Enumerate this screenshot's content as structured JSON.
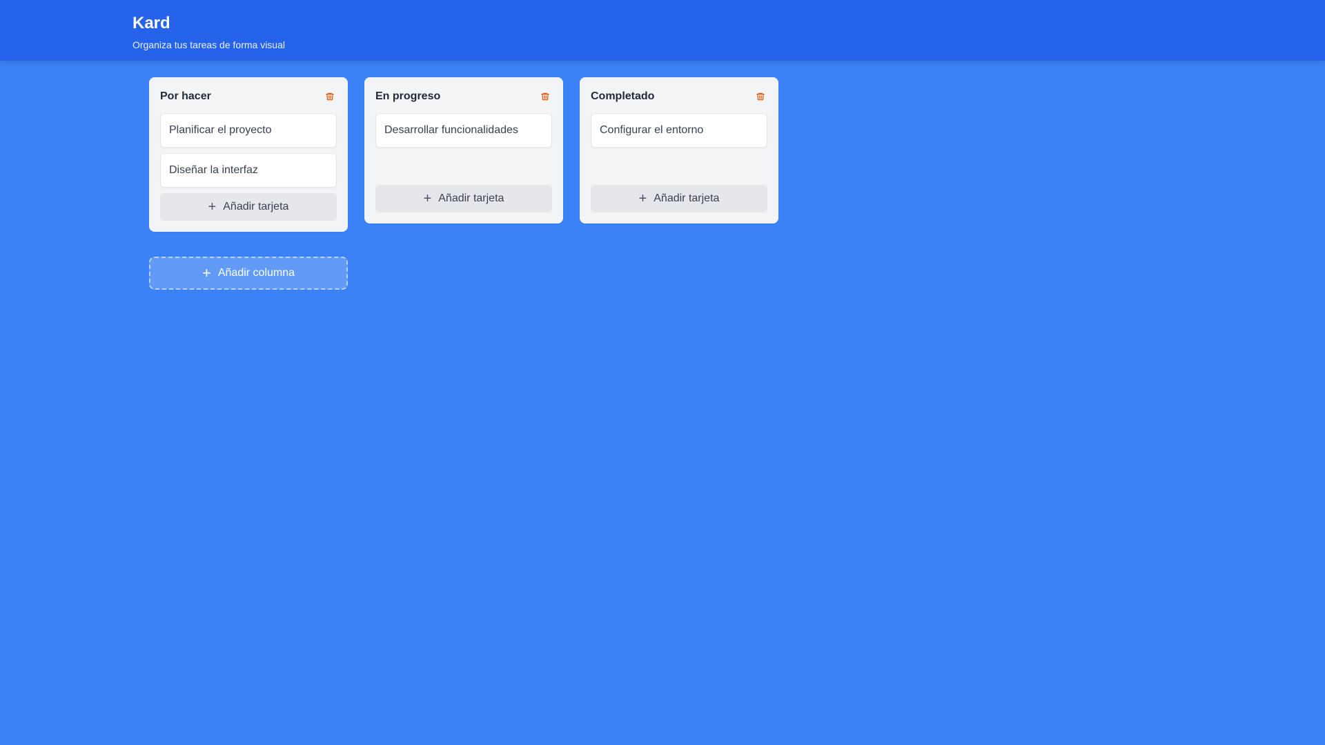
{
  "header": {
    "title": "Kard",
    "subtitle": "Organiza tus tareas de forma visual"
  },
  "columns": [
    {
      "title": "Por hacer",
      "cards": [
        "Planificar el proyecto",
        "Diseñar la interfaz"
      ],
      "add_card_label": "Añadir tarjeta"
    },
    {
      "title": "En progreso",
      "cards": [
        "Desarrollar funcionalidades"
      ],
      "add_card_label": "Añadir tarjeta"
    },
    {
      "title": "Completado",
      "cards": [
        "Configurar el entorno"
      ],
      "add_card_label": "Añadir tarjeta"
    }
  ],
  "add_column_label": "Añadir columna",
  "icons": {
    "delete": "trash-icon",
    "add": "plus-icon"
  },
  "colors": {
    "background": "#3b82f6",
    "header": "#2563eb",
    "trash": "#ea580c"
  }
}
